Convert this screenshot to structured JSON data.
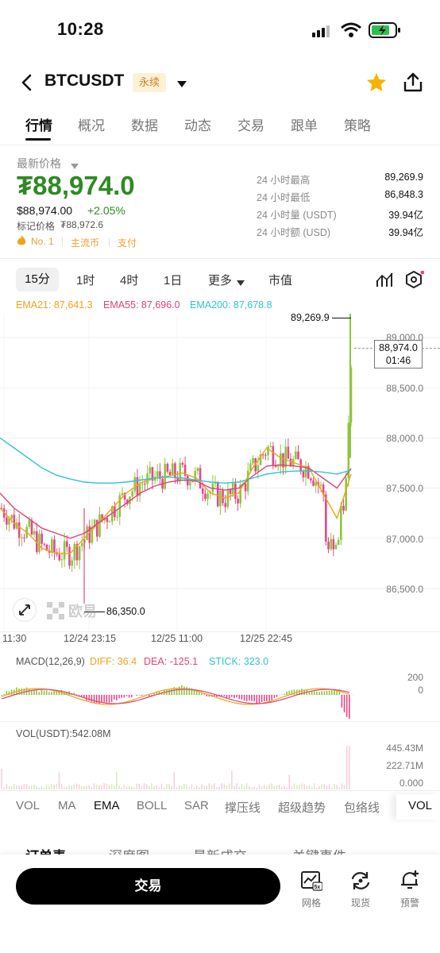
{
  "status_bar": {
    "time": "10:28"
  },
  "header": {
    "symbol": "BTCUSDT",
    "contract_badge": "永续"
  },
  "tabs": [
    "行情",
    "概况",
    "数据",
    "动态",
    "交易",
    "跟单",
    "策略"
  ],
  "price": {
    "latest_label": "最新价格",
    "currency_symbol": "₮",
    "last_price": "88,974.0",
    "usd_price": "$88,974.00",
    "change": "+2.05%",
    "mark_price_label": "标记价格",
    "mark_price": "₮88,972.6",
    "tags": [
      "No. 1",
      "主流币",
      "支付"
    ]
  },
  "stats": [
    {
      "label": "24 小时最高",
      "value": "89,269.9"
    },
    {
      "label": "24 小时最低",
      "value": "86,848.3"
    },
    {
      "label": "24 小时量 (USDT)",
      "value": "39.94亿"
    },
    {
      "label": "24 小时额 (USD)",
      "value": "39.94亿"
    }
  ],
  "timeframes": {
    "active": "15分",
    "items": [
      "1时",
      "4时",
      "1日",
      "更多",
      "市值"
    ]
  },
  "ema_legend": {
    "ema21": "EMA21: 87,641.3",
    "ema55": "EMA55: 87,696.0",
    "ema200": "EMA200: 87,678.8"
  },
  "colors": {
    "up": "#8cc63e",
    "down": "#e2498a",
    "ema21": "#f0a21a",
    "ema55": "#e24275",
    "ema200": "#2ec4cf",
    "price_green": "#2f8a23"
  },
  "chart_labels": {
    "high_label": "89,269.9",
    "low_label": "86,350.0",
    "current_price_box": "88,974.0",
    "countdown": "01:46",
    "watermark": "欧易"
  },
  "chart_data": {
    "type": "line",
    "y_ticks": [
      "89,000.0",
      "88,500.0",
      "88,000.0",
      "87,500.0",
      "87,000.0",
      "86,500.0"
    ],
    "x_ticks": [
      "11:30",
      "12/24 23:15",
      "12/25 11:00",
      "12/25 22:45"
    ],
    "ylim": [
      86350,
      89400
    ],
    "series": [
      {
        "name": "EMA21",
        "values": [
          87300,
          87150,
          87050,
          86900,
          86850,
          86850,
          87000,
          87150,
          87300,
          87450,
          87550,
          87600,
          87620,
          87650,
          87600,
          87450,
          87400,
          87450,
          87700,
          87900,
          87800,
          87750,
          87700,
          87450,
          87200,
          87640
        ]
      },
      {
        "name": "EMA55",
        "values": [
          87450,
          87300,
          87200,
          87100,
          87050,
          87000,
          87050,
          87150,
          87250,
          87350,
          87450,
          87520,
          87560,
          87580,
          87570,
          87500,
          87480,
          87500,
          87620,
          87720,
          87730,
          87720,
          87700,
          87600,
          87500,
          87696
        ]
      },
      {
        "name": "EMA200",
        "values": [
          88000,
          87900,
          87800,
          87700,
          87630,
          87590,
          87560,
          87550,
          87550,
          87560,
          87580,
          87600,
          87610,
          87600,
          87580,
          87560,
          87550,
          87560,
          87600,
          87640,
          87660,
          87670,
          87670,
          87660,
          87640,
          87679
        ]
      }
    ]
  },
  "macd": {
    "label": "MACD(12,26,9)",
    "diff": "DIFF: 36.4",
    "dea": "DEA: -125.1",
    "stick": "STICK: 323.0",
    "ticks": [
      "200",
      "0"
    ]
  },
  "volume": {
    "label": "VOL(USDT):542.08M",
    "ticks": [
      "445.43M",
      "222.71M",
      "0.000"
    ]
  },
  "indicator_tabs": [
    "VOL",
    "MA",
    "EMA",
    "BOLL",
    "SAR",
    "撑压线",
    "超级趋势",
    "包络线",
    "VOL"
  ],
  "lower_tabs": [
    "订单表",
    "深度图",
    "最新成交",
    "关键事件"
  ],
  "bottom_bar": {
    "trade_button": "交易",
    "grid": "网格",
    "spot": "现货",
    "alert": "预警",
    "grid_badge": "5x"
  }
}
